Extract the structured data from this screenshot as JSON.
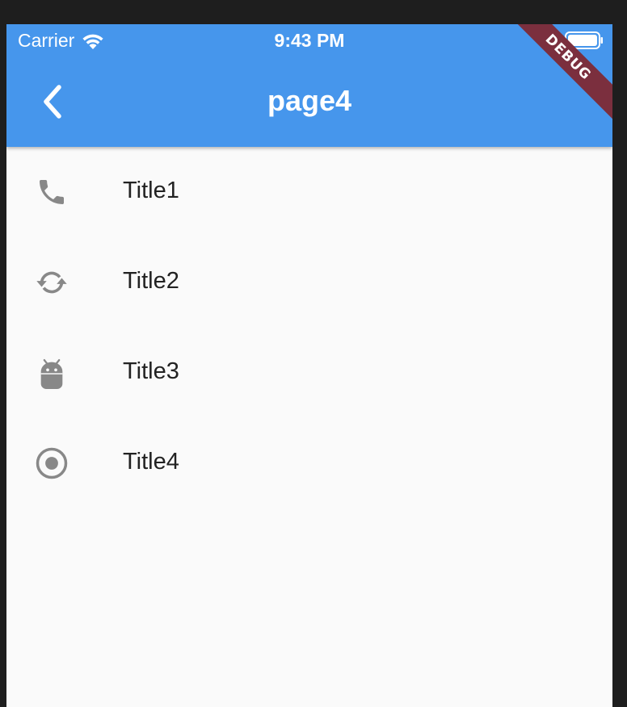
{
  "status_bar": {
    "carrier": "Carrier",
    "time": "9:43 PM"
  },
  "app_bar": {
    "title": "page4",
    "background_color": "#4696ec"
  },
  "debug_banner": {
    "label": "DEBUG",
    "color": "#7b2f3e"
  },
  "list": {
    "items": [
      {
        "icon": "phone-icon",
        "title": "Title1"
      },
      {
        "icon": "sync-icon",
        "title": "Title2"
      },
      {
        "icon": "android-icon",
        "title": "Title3"
      },
      {
        "icon": "radio-button-checked-icon",
        "title": "Title4"
      }
    ],
    "icon_color": "#888888"
  }
}
